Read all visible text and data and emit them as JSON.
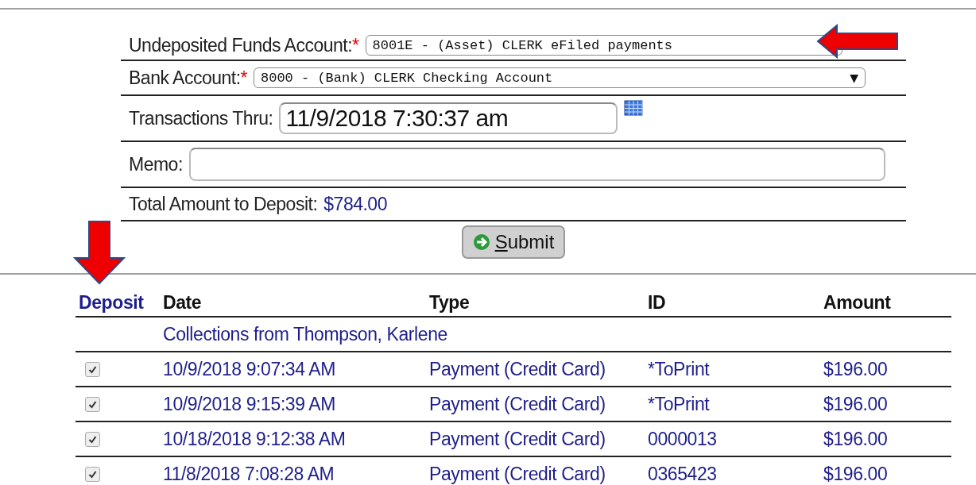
{
  "form": {
    "undeposited": {
      "label": "Undeposited Funds Account:",
      "required": "*",
      "value": "8001E - (Asset) CLERK eFiled payments"
    },
    "bank": {
      "label": "Bank Account:",
      "required": "*",
      "value": "8000 - (Bank) CLERK Checking Account",
      "caret": "▼"
    },
    "thru": {
      "label": "Transactions Thru:",
      "value": "11/9/2018 7:30:37 am"
    },
    "memo": {
      "label": "Memo:"
    },
    "total": {
      "label": "Total Amount to Deposit:",
      "value": "$784.00"
    },
    "submit": {
      "label": "Submit"
    }
  },
  "table": {
    "columns": [
      "Deposit",
      "Date",
      "Type",
      "ID",
      "Amount"
    ],
    "group": "Collections from Thompson, Karlene",
    "rows": [
      {
        "checked": true,
        "date": "10/9/2018 9:07:34 AM",
        "type": "Payment (Credit Card)",
        "id": "*ToPrint",
        "amount": "$196.00"
      },
      {
        "checked": true,
        "date": "10/9/2018 9:15:39 AM",
        "type": "Payment (Credit Card)",
        "id": "*ToPrint",
        "amount": "$196.00"
      },
      {
        "checked": true,
        "date": "10/18/2018 9:12:38 AM",
        "type": "Payment (Credit Card)",
        "id": "0000013",
        "amount": "$196.00"
      },
      {
        "checked": true,
        "date": "11/8/2018 7:08:28 AM",
        "type": "Payment (Credit Card)",
        "id": "0365423",
        "amount": "$196.00"
      }
    ]
  }
}
